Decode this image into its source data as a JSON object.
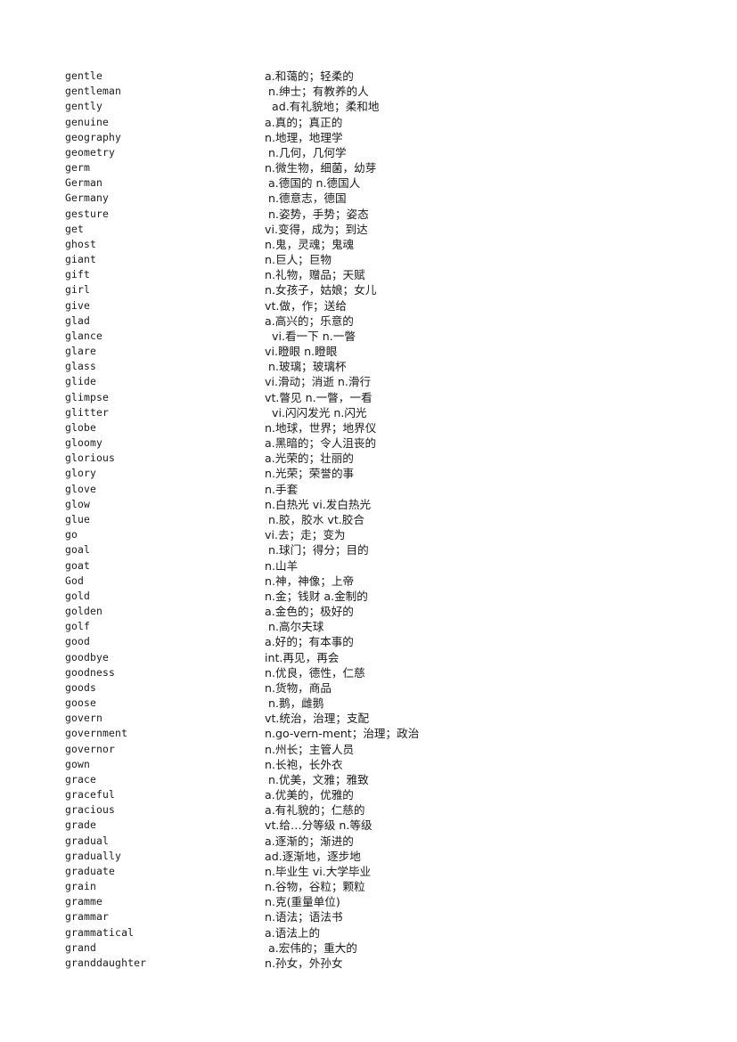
{
  "document": {
    "type": "vocabulary-word-list",
    "page_background": "#ffffff",
    "text_color": "#1a1a1a",
    "letter_section": "G",
    "entry_count": 58,
    "columns": {
      "term_header": "",
      "definition_header": ""
    }
  },
  "entries": [
    {
      "term": "gentle",
      "definition": "a.和蔼的；轻柔的"
    },
    {
      "term": "gentleman",
      "definition": " n.绅士；有教养的人"
    },
    {
      "term": "gently",
      "definition": "  ad.有礼貌地；柔和地"
    },
    {
      "term": "genuine",
      "definition": "a.真的；真正的"
    },
    {
      "term": "geography",
      "definition": "n.地理，地理学"
    },
    {
      "term": "geometry",
      "definition": " n.几何，几何学"
    },
    {
      "term": "germ",
      "definition": "n.微生物，细菌，幼芽"
    },
    {
      "term": "German",
      "definition": " a.德国的 n.德国人"
    },
    {
      "term": "Germany",
      "definition": " n.德意志，德国"
    },
    {
      "term": "gesture",
      "definition": " n.姿势，手势；姿态"
    },
    {
      "term": "get",
      "definition": "vi.变得，成为；到达"
    },
    {
      "term": "ghost",
      "definition": "n.鬼，灵魂；鬼魂"
    },
    {
      "term": "giant",
      "definition": "n.巨人；巨物"
    },
    {
      "term": "gift",
      "definition": "n.礼物，赠品；天赋"
    },
    {
      "term": "girl",
      "definition": "n.女孩子，姑娘；女儿"
    },
    {
      "term": "give",
      "definition": "vt.做，作；送给"
    },
    {
      "term": "glad",
      "definition": "a.高兴的；乐意的"
    },
    {
      "term": "glance",
      "definition": "  vi.看一下 n.一瞥"
    },
    {
      "term": "glare",
      "definition": "vi.瞪眼 n.瞪眼"
    },
    {
      "term": "glass",
      "definition": " n.玻璃；玻璃杯"
    },
    {
      "term": "glide",
      "definition": "vi.滑动；消逝 n.滑行"
    },
    {
      "term": "glimpse",
      "definition": "vt.瞥见 n.一瞥，一看"
    },
    {
      "term": "glitter",
      "definition": "  vi.闪闪发光 n.闪光"
    },
    {
      "term": "globe",
      "definition": "n.地球，世界；地界仪"
    },
    {
      "term": "gloomy",
      "definition": "a.黑暗的；令人沮丧的"
    },
    {
      "term": "glorious",
      "definition": "a.光荣的；壮丽的"
    },
    {
      "term": "glory",
      "definition": "n.光荣；荣誉的事"
    },
    {
      "term": "glove",
      "definition": "n.手套"
    },
    {
      "term": "glow",
      "definition": "n.白热光 vi.发白热光"
    },
    {
      "term": "glue",
      "definition": " n.胶，胶水 vt.胶合"
    },
    {
      "term": "go",
      "definition": "vi.去；走；变为"
    },
    {
      "term": "goal",
      "definition": " n.球门；得分；目的"
    },
    {
      "term": "goat",
      "definition": "n.山羊"
    },
    {
      "term": "God",
      "definition": "n.神，神像；上帝"
    },
    {
      "term": "gold",
      "definition": "n.金；钱财 a.金制的"
    },
    {
      "term": "golden",
      "definition": "a.金色的；极好的"
    },
    {
      "term": "golf",
      "definition": " n.高尔夫球"
    },
    {
      "term": "good",
      "definition": "a.好的；有本事的"
    },
    {
      "term": "goodbye",
      "definition": "int.再见，再会"
    },
    {
      "term": "goodness",
      "definition": "n.优良，德性，仁慈"
    },
    {
      "term": "goods",
      "definition": "n.货物，商品"
    },
    {
      "term": "goose",
      "definition": " n.鹅，雌鹅"
    },
    {
      "term": "govern",
      "definition": "vt.统治，治理；支配"
    },
    {
      "term": "government",
      "definition": "n.go-vern-ment；治理；政治"
    },
    {
      "term": "governor",
      "definition": "n.州长；主管人员"
    },
    {
      "term": "gown",
      "definition": "n.长袍，长外衣"
    },
    {
      "term": "grace",
      "definition": " n.优美，文雅；雅致"
    },
    {
      "term": "graceful",
      "definition": "a.优美的，优雅的"
    },
    {
      "term": "gracious",
      "definition": "a.有礼貌的；仁慈的"
    },
    {
      "term": "grade",
      "definition": "vt.给…分等级 n.等级"
    },
    {
      "term": "gradual",
      "definition": "a.逐渐的；渐进的"
    },
    {
      "term": "gradually",
      "definition": "ad.逐渐地，逐步地"
    },
    {
      "term": "graduate",
      "definition": "n.毕业生 vi.大学毕业"
    },
    {
      "term": "grain",
      "definition": "n.谷物，谷粒；颗粒"
    },
    {
      "term": "gramme",
      "definition": "n.克(重量单位)"
    },
    {
      "term": "grammar",
      "definition": "n.语法；语法书"
    },
    {
      "term": "grammatical",
      "definition": "a.语法上的"
    },
    {
      "term": "grand",
      "definition": " a.宏伟的；重大的"
    },
    {
      "term": "granddaughter",
      "definition": "n.孙女，外孙女"
    }
  ]
}
